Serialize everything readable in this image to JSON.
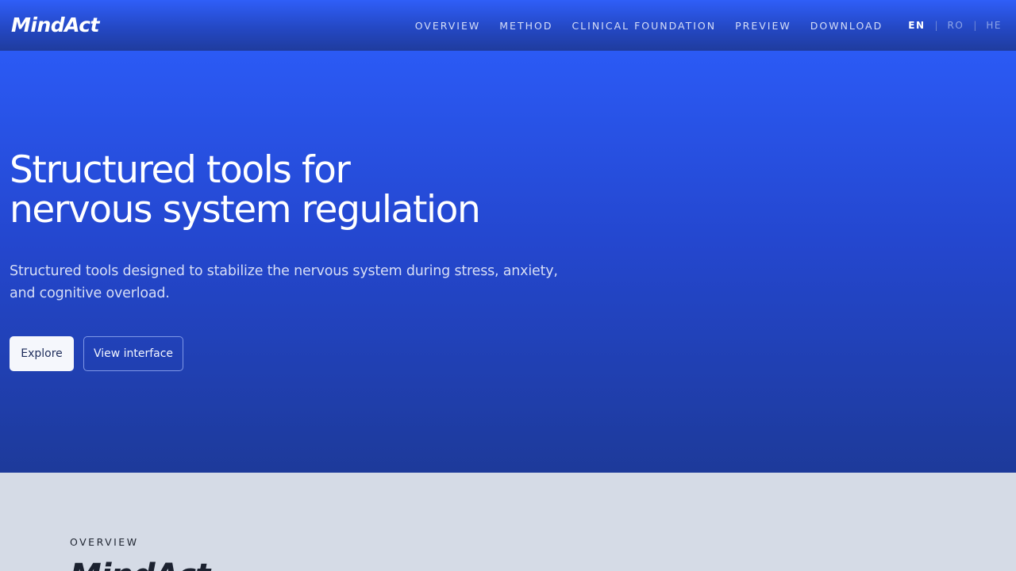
{
  "header": {
    "logo_text": "MindAct",
    "nav": [
      {
        "label": "OVERVIEW"
      },
      {
        "label": "METHOD"
      },
      {
        "label": "CLINICAL FOUNDATION"
      },
      {
        "label": "PREVIEW"
      },
      {
        "label": "DOWNLOAD"
      }
    ],
    "languages": [
      {
        "label": "EN",
        "active": true
      },
      {
        "label": "RO",
        "active": false
      },
      {
        "label": "HE",
        "active": false
      }
    ],
    "language_separator": "|"
  },
  "hero": {
    "title_line1": "Structured tools for",
    "title_line2": "nervous system regulation",
    "subtitle": "Structured tools designed to stabilize the nervous system during stress, anxiety, and cognitive overload.",
    "primary_button": "Explore",
    "secondary_button": "View interface"
  },
  "overview": {
    "label": "OVERVIEW",
    "logo_text": "MindAct"
  },
  "colors": {
    "hero_top": "#2b5af5",
    "hero_bottom": "#1d3a9a",
    "section_bg": "#d5dbe6",
    "text_dark": "#1e2430"
  }
}
